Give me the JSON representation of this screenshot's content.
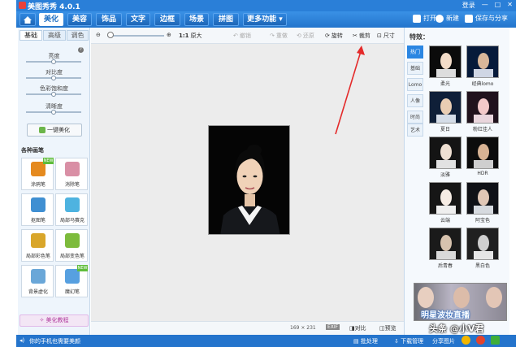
{
  "app": {
    "title": "美图秀秀 4.0.1"
  },
  "titlebar": {
    "login": "登录",
    "minimize": "—",
    "restore": "□",
    "close": "✕"
  },
  "nav": {
    "tabs": [
      "美化",
      "美容",
      "饰品",
      "文字",
      "边框",
      "场景",
      "拼图",
      "更多功能 ▾"
    ],
    "open_label": "打开",
    "new_label": "新建",
    "save_label": "保存与分享"
  },
  "left": {
    "subtabs": [
      "基础",
      "高级",
      "调色"
    ],
    "sliders": [
      {
        "label": "亮度",
        "value": 0.5
      },
      {
        "label": "对比度",
        "value": 0.5
      },
      {
        "label": "色彩饱和度",
        "value": 0.5
      },
      {
        "label": "清晰度",
        "value": 0.5
      }
    ],
    "one_click": "一键美化",
    "brush_title": "各种画笔",
    "brushes": [
      {
        "label": "涂鸦笔",
        "icon": "pen-icon",
        "color": "#e58a1f",
        "new": true
      },
      {
        "label": "消除笔",
        "icon": "eraser-icon",
        "color": "#d98fa5",
        "new": false
      },
      {
        "label": "抠图笔",
        "icon": "cutout-icon",
        "color": "#3f8fd2",
        "new": false
      },
      {
        "label": "局部马赛克",
        "icon": "mosaic-icon",
        "color": "#4eb3e0",
        "new": false
      },
      {
        "label": "局部彩色笔",
        "icon": "color-brush-icon",
        "color": "#d9a62a",
        "new": false
      },
      {
        "label": "局部变色笔",
        "icon": "recolor-brush-icon",
        "color": "#7dbb3c",
        "new": false
      },
      {
        "label": "背景虚化",
        "icon": "blur-bg-icon",
        "color": "#6aa7d8",
        "new": false
      },
      {
        "label": "魔幻笔",
        "icon": "magic-pen-icon",
        "color": "#57a0e0",
        "new": true
      }
    ],
    "new_tag": "NEW",
    "tutorial": "美化教程"
  },
  "toolbar": {
    "zoom_label": "1:1",
    "original_label": "原大",
    "undo_label": "撤销",
    "redo_label": "重做",
    "reset_label": "还原",
    "rotate_label": "旋转",
    "crop_label": "裁剪",
    "size_label": "尺寸"
  },
  "status": {
    "dims": "169 × 231",
    "exif": "EXIF",
    "compare": "对比",
    "preview": "预览"
  },
  "right": {
    "title": "特效：",
    "categories": [
      "热门",
      "基础",
      "Lomo",
      "人像",
      "时尚",
      "艺术"
    ],
    "effects": [
      {
        "name": "柔光",
        "bg": "#0b0b0b"
      },
      {
        "name": "经典lomo",
        "bg": "#061a3a"
      },
      {
        "name": "夏日",
        "bg": "#0f1f38"
      },
      {
        "name": "粉红佳人",
        "bg": "#20121c"
      },
      {
        "name": "淡雅",
        "bg": "#141414"
      },
      {
        "name": "HDR",
        "bg": "#0c0c0c"
      },
      {
        "name": "云端",
        "bg": "#161616"
      },
      {
        "name": "阿宝色",
        "bg": "#0f1116"
      },
      {
        "name": "后青春",
        "bg": "#1a1a1a"
      },
      {
        "name": "黑白色",
        "bg": "#202020"
      }
    ],
    "ad_text": "明星波妆直播"
  },
  "bottom": {
    "tip": "你的手机也需要美颜",
    "batch": "批处理",
    "download": "下载管理",
    "share": "分享图片"
  },
  "watermark": "头条 @小V君",
  "colors": {
    "accent": "#2a7fd8",
    "new_tag": "#5fbd3b"
  }
}
